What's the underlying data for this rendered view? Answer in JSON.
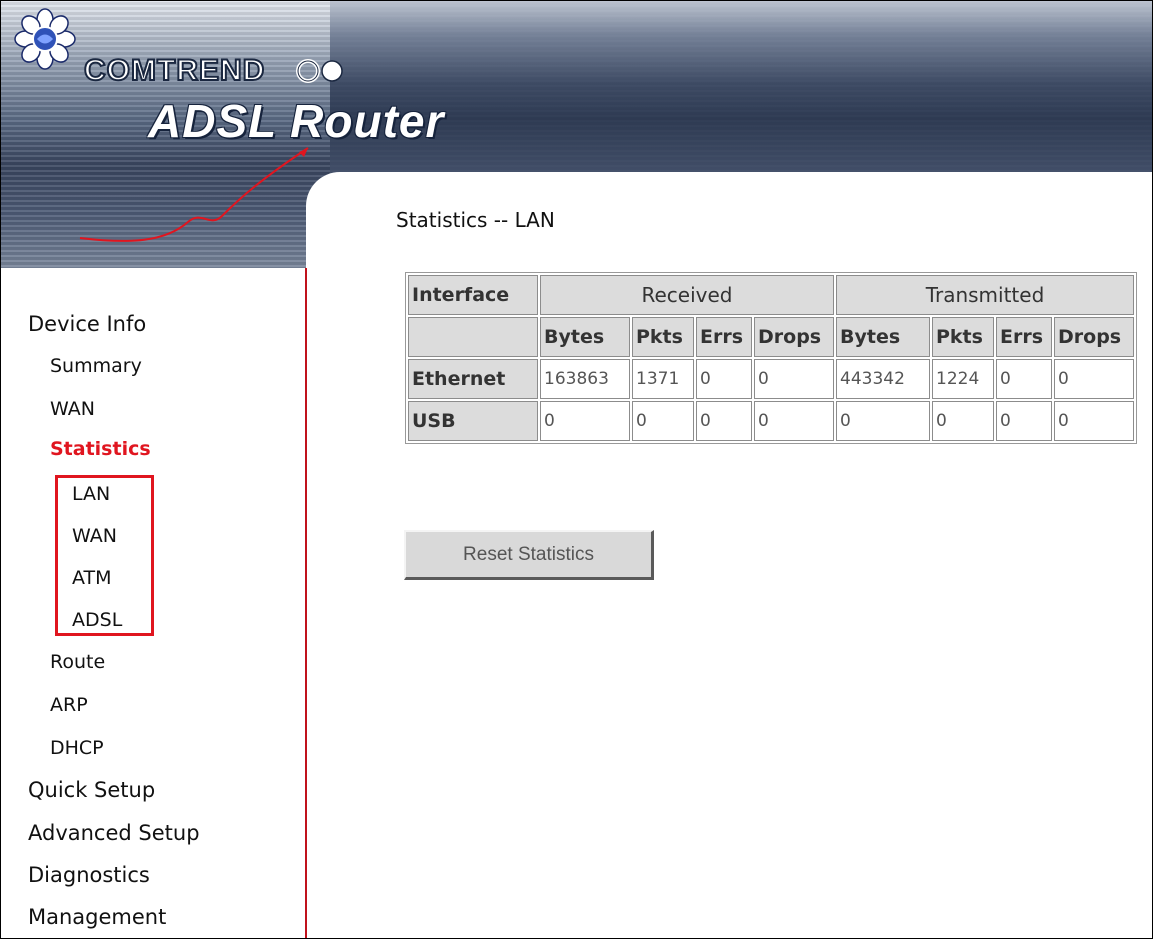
{
  "header": {
    "brand": "COMTREND",
    "product": "ADSL Router"
  },
  "sidebar": {
    "items": [
      {
        "label": "Device Info",
        "level": 0
      },
      {
        "label": "Summary",
        "level": 1
      },
      {
        "label": "WAN",
        "level": 1
      },
      {
        "label": "Statistics",
        "level": 1,
        "active": true
      },
      {
        "label": "LAN",
        "level": 2
      },
      {
        "label": "WAN",
        "level": 2
      },
      {
        "label": "ATM",
        "level": 2
      },
      {
        "label": "ADSL",
        "level": 2
      },
      {
        "label": "Route",
        "level": 1
      },
      {
        "label": "ARP",
        "level": 1
      },
      {
        "label": "DHCP",
        "level": 1
      },
      {
        "label": "Quick Setup",
        "level": 0
      },
      {
        "label": "Advanced Setup",
        "level": 0
      },
      {
        "label": "Diagnostics",
        "level": 0
      },
      {
        "label": "Management",
        "level": 0
      }
    ]
  },
  "main": {
    "title": "Statistics -- LAN",
    "table": {
      "interface_header": "Interface",
      "group_headers": [
        "Received",
        "Transmitted"
      ],
      "sub_headers": [
        "Bytes",
        "Pkts",
        "Errs",
        "Drops",
        "Bytes",
        "Pkts",
        "Errs",
        "Drops"
      ],
      "rows": [
        {
          "name": "Ethernet",
          "values": [
            "163863",
            "1371",
            "0",
            "0",
            "443342",
            "1224",
            "0",
            "0"
          ]
        },
        {
          "name": "USB",
          "values": [
            "0",
            "0",
            "0",
            "0",
            "0",
            "0",
            "0",
            "0"
          ]
        }
      ]
    },
    "reset_button": "Reset Statistics"
  },
  "colors": {
    "accent": "#e0151f",
    "table_header_bg": "#dcdcdc"
  }
}
